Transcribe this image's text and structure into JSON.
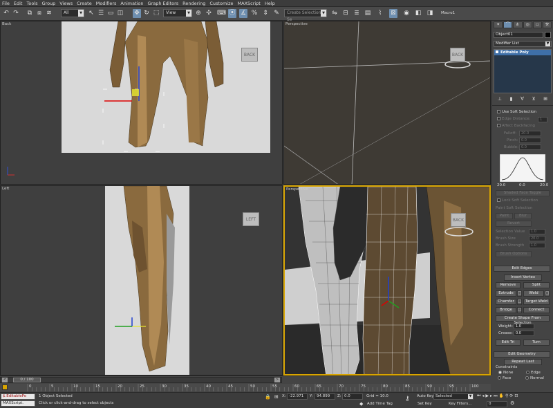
{
  "menu": [
    "File",
    "Edit",
    "Tools",
    "Group",
    "Views",
    "Create",
    "Modifiers",
    "Animation",
    "Graph Editors",
    "Rendering",
    "Customize",
    "MAXScript",
    "Help"
  ],
  "toolbar": {
    "filter_value": "All",
    "coord_value": "View",
    "selection_set_placeholder": "Create Selection Se",
    "macro_label": "Macro1"
  },
  "viewports": {
    "top_left": {
      "label": "Back",
      "cube_label": "BACK"
    },
    "top_right": {
      "label": "Perspective",
      "cube_label": "BACK"
    },
    "bottom_left": {
      "label": "Left",
      "cube_label": "LEFT"
    },
    "bottom_right": {
      "label": "Perspective",
      "cube_label": "BACK"
    }
  },
  "command_panel": {
    "object_name": "Object01",
    "object_color": "#000000",
    "modifier_list_label": "Modifier List",
    "stack_item": "Editable Poly",
    "soft_selection": {
      "use_soft_selection": "Use Soft Selection",
      "edge_distance": "Edge Distance:",
      "edge_distance_value": "1",
      "affect_backfacing": "Affect Backfacing",
      "falloff_label": "Falloff:",
      "falloff_value": "20.0",
      "pinch_label": "Pinch:",
      "pinch_value": "0.0",
      "bubble_label": "Bubble:",
      "bubble_value": "0.0",
      "curve_min": "20.0",
      "curve_mid": "0.0",
      "curve_max": "20.0",
      "shaded_face_toggle": "Shaded Face Toggle",
      "lock_soft_selection": "Lock Soft Selection",
      "paint_soft_selection": "Paint Soft Selection",
      "paint_btn": "Paint",
      "blur_btn": "Blur",
      "revert_btn": "Revert",
      "selection_value_label": "Selection Value",
      "selection_value": "1.0",
      "brush_size_label": "Brush Size",
      "brush_size": "20.0",
      "brush_strength_label": "Brush Strength",
      "brush_strength": "1.0",
      "brush_options": "Brush Options"
    },
    "edit_edges": {
      "title": "Edit Edges",
      "insert_vertex": "Insert Vertex",
      "remove": "Remove",
      "split": "Split",
      "extrude": "Extrude",
      "weld": "Weld",
      "chamfer": "Chamfer",
      "target_weld": "Target Weld",
      "bridge": "Bridge",
      "connect": "Connect",
      "create_shape": "Create Shape From Selection",
      "weight_label": "Weight:",
      "weight_value": "1.0",
      "crease_label": "Crease:",
      "crease_value": "0.0",
      "edit_tri": "Edit Tri",
      "turn": "Turn"
    },
    "edit_geometry": {
      "title": "Edit Geometry",
      "repeat_last": "Repeat Last",
      "constraints": "Constraints",
      "none": "None",
      "edge": "Edge",
      "face": "Face",
      "normal": "Normal"
    }
  },
  "timeline": {
    "frame_display": "0 / 100",
    "ticks": [
      "0",
      "5",
      "10",
      "15",
      "20",
      "25",
      "30",
      "35",
      "40",
      "45",
      "50",
      "55",
      "60",
      "65",
      "70",
      "75",
      "80",
      "85",
      "90",
      "95",
      "100"
    ]
  },
  "status": {
    "script_listener": "$.EditablePo",
    "maxscript_label": "MAXScript.",
    "selected_count": "1 Object Selected",
    "prompt": "Click or click-and-drag to select objects",
    "x_label": "X:",
    "x_value": "-22.971",
    "y_label": "Y:",
    "y_value": "94.899",
    "z_label": "Z:",
    "z_value": "0.0",
    "grid": "Grid = 10.0",
    "add_time_tag": "Add Time Tag",
    "auto_key": "Auto Key",
    "auto_key_value": "Selected",
    "set_key": "Set Key",
    "key_filters": "Key Filters...",
    "frame_value": "0"
  }
}
